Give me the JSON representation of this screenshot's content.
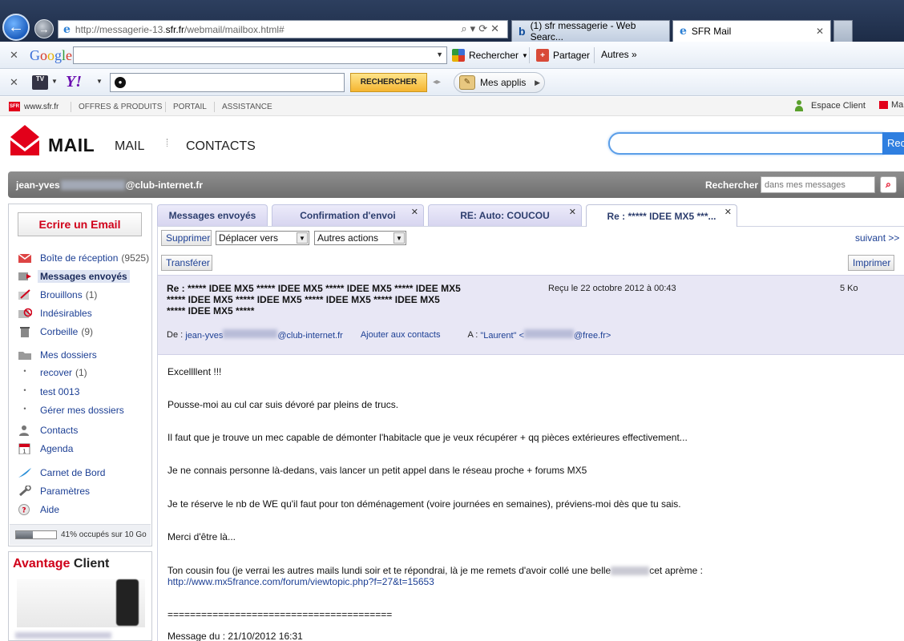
{
  "browser": {
    "url_prefix": "http://messagerie-13.",
    "url_host": "sfr.fr",
    "url_path": "/webmail/mailbox.html#",
    "tabs": [
      {
        "label": "(1) sfr messagerie - Web Searc..."
      },
      {
        "label": "SFR Mail"
      }
    ]
  },
  "google_toolbar": {
    "logo": "Google",
    "rechercher": "Rechercher",
    "partager": "Partager",
    "autres": "Autres »"
  },
  "yahoo_toolbar": {
    "tv": "TV",
    "logo": "Y!",
    "search_button": "RECHERCHER",
    "applis": "Mes applis"
  },
  "sfr_nav": {
    "site": "www.sfr.fr",
    "items": [
      "OFFRES & PRODUITS",
      "PORTAIL",
      "ASSISTANCE"
    ],
    "espace_client": "Espace Client",
    "ma": "Ma"
  },
  "header": {
    "title": "MAIL",
    "nav_mail": "MAIL",
    "nav_contacts": "CONTACTS",
    "search_btn": "Rec"
  },
  "user_bar": {
    "email_prefix": "jean-yves",
    "email_suffix": "@club-internet.fr",
    "rechercher": "Rechercher",
    "search_placeholder": "dans mes messages"
  },
  "sidebar": {
    "write_button": "Ecrire un Email",
    "items": [
      {
        "label": "Boîte de réception",
        "count": "(9525)"
      },
      {
        "label": "Messages envoyés",
        "count": ""
      },
      {
        "label": "Brouillons",
        "count": "(1)"
      },
      {
        "label": "Indésirables",
        "count": ""
      },
      {
        "label": "Corbeille",
        "count": "(9)"
      },
      {
        "label": "Mes dossiers",
        "count": ""
      },
      {
        "label": "recover",
        "count": "(1)"
      },
      {
        "label": "test 0013",
        "count": ""
      },
      {
        "label": "Gérer mes dossiers",
        "count": ""
      },
      {
        "label": "Contacts",
        "count": ""
      },
      {
        "label": "Agenda",
        "count": ""
      },
      {
        "label": "Carnet de Bord",
        "count": ""
      },
      {
        "label": "Paramètres",
        "count": ""
      },
      {
        "label": "Aide",
        "count": ""
      }
    ],
    "quota_text": "41% occupés sur 10 Go",
    "quota_fraction": 0.41
  },
  "avantage": {
    "word1": "Avantage",
    "word2": "Client"
  },
  "tabs": [
    {
      "label": "Messages envoyés",
      "closable": false
    },
    {
      "label": "Confirmation d'envoi",
      "closable": true
    },
    {
      "label": "RE: Auto: COUCOU",
      "closable": true
    },
    {
      "label": "Re : ***** IDEE MX5 ***...",
      "closable": true
    }
  ],
  "actions": {
    "supprimer": "Supprimer",
    "deplacer": "Déplacer vers",
    "autres": "Autres actions",
    "suivant": "suivant >>",
    "transferer": "Transférer",
    "imprimer": "Imprimer"
  },
  "message": {
    "subject_line1": "Re : ***** IDEE MX5 ***** IDEE MX5 ***** IDEE MX5 ***** IDEE MX5",
    "subject_line2": "***** IDEE MX5 ***** IDEE MX5 ***** IDEE MX5 ***** IDEE MX5",
    "subject_line3": "***** IDEE MX5 *****",
    "received": "Reçu le 22 octobre 2012 à 00:43",
    "size": "5 Ko",
    "from_label": "De :",
    "from_prefix": "jean-yves",
    "from_suffix": "@club-internet.fr",
    "add_contact": "Ajouter aux contacts",
    "to_label": "A :",
    "to_name": "\"Laurent\" <",
    "to_suffix": "@free.fr>",
    "body": [
      "Excellllent !!!",
      "Pousse-moi au cul car suis dévoré par pleins de trucs.",
      "Il faut que je trouve un mec capable de démonter l'habitacle que je veux récupérer + qq pièces extérieures effectivement...",
      "Je ne connais personne là-dedans, vais lancer un petit appel dans le réseau proche + forums MX5",
      "Je te réserve le nb de WE qu'il faut pour ton déménagement (voire journées en semaines), préviens-moi dès que tu sais.",
      "Merci d'être là...",
      "Ton cousin fou (je verrai les autres mails lundi soir et te répondrai, là je me remets d'avoir collé une belle",
      "cet aprème :",
      "http://www.mx5france.com/forum/viewtopic.php?f=27&t=15653",
      "========================================",
      "Message du : 21/10/2012 16:31"
    ]
  }
}
